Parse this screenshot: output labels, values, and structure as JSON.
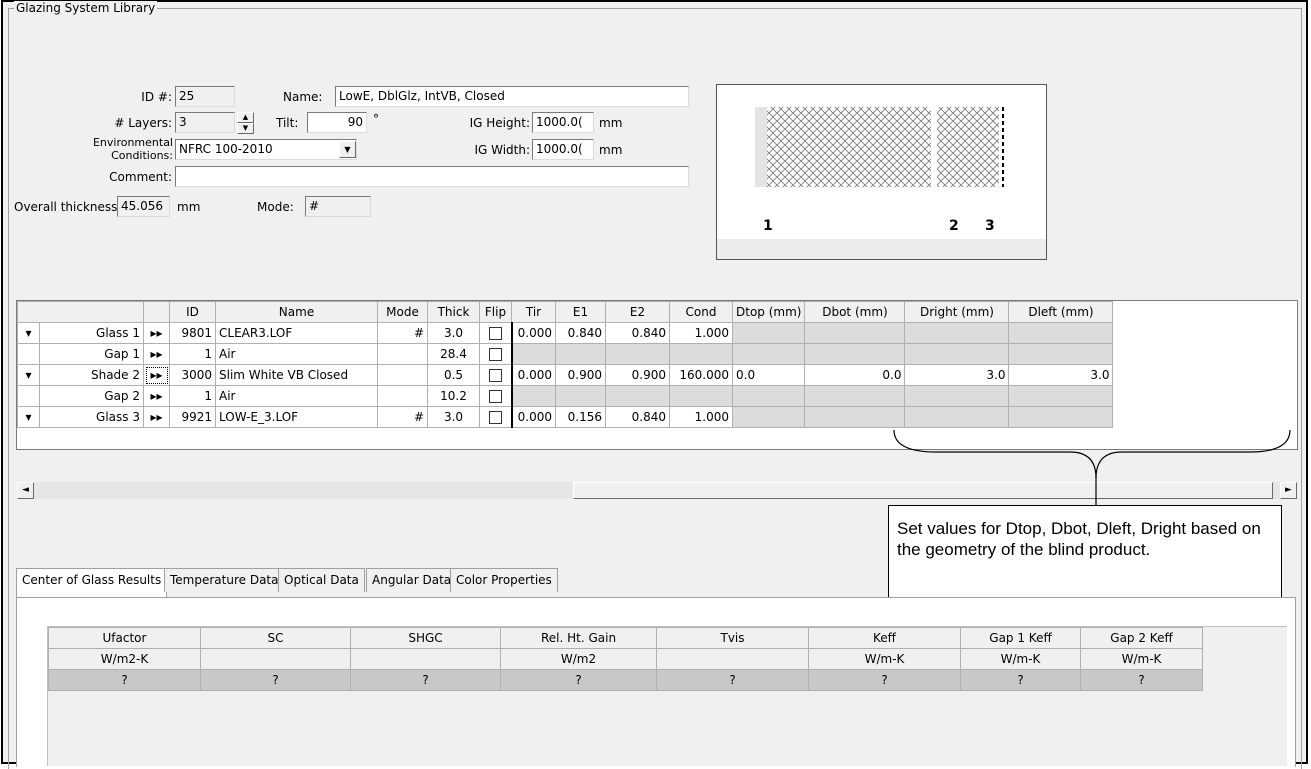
{
  "group_title": "Glazing System Library",
  "form": {
    "id_label": "ID #:",
    "id_value": "25",
    "name_label": "Name:",
    "name_value": "LowE, DblGlz, IntVB, Closed",
    "layers_label": "# Layers:",
    "layers_value": "3",
    "tilt_label": "Tilt:",
    "tilt_value": "90",
    "tilt_unit": "°",
    "ig_height_label": "IG Height:",
    "ig_height_value": "1000.0(",
    "ig_height_unit": "mm",
    "env_label_1": "Environmental",
    "env_label_2": "Conditions:",
    "env_value": "NFRC 100-2010",
    "ig_width_label": "IG Width:",
    "ig_width_value": "1000.0(",
    "ig_width_unit": "mm",
    "comment_label": "Comment:",
    "comment_value": "",
    "overall_label": "Overall thickness:",
    "overall_value": "45.056",
    "overall_unit": "mm",
    "mode_label": "Mode:",
    "mode_value": "#"
  },
  "preview": {
    "labels": [
      "1",
      "2",
      "3"
    ]
  },
  "layer_table": {
    "headers": [
      "",
      "",
      "ID",
      "Name",
      "Mode",
      "Thick",
      "Flip",
      "Tir",
      "E1",
      "E2",
      "Cond",
      "Dtop (mm)",
      "Dbot (mm)",
      "Dright (mm)",
      "Dleft (mm)"
    ],
    "rows": [
      {
        "label": "Glass 1",
        "id": "9801",
        "name": "CLEAR3.LOF",
        "mode": "#",
        "thick": "3.0",
        "tir": "0.000",
        "e1": "0.840",
        "e2": "0.840",
        "cond": "1.000",
        "dtop": "",
        "dbot": "",
        "dright": "",
        "dleft": ""
      },
      {
        "label": "Gap 1",
        "id": "1",
        "name": "Air",
        "mode": "",
        "thick": "28.4",
        "tir": "",
        "e1": "",
        "e2": "",
        "cond": "",
        "dtop": "",
        "dbot": "",
        "dright": "",
        "dleft": ""
      },
      {
        "label": "Shade 2",
        "id": "3000",
        "name": "Slim White VB Closed",
        "mode": "",
        "thick": "0.5",
        "tir": "0.000",
        "e1": "0.900",
        "e2": "0.900",
        "cond": "160.000",
        "dtop": "0.0",
        "dbot": "0.0",
        "dright": "3.0",
        "dleft": "3.0"
      },
      {
        "label": "Gap 2",
        "id": "1",
        "name": "Air",
        "mode": "",
        "thick": "10.2",
        "tir": "",
        "e1": "",
        "e2": "",
        "cond": "",
        "dtop": "",
        "dbot": "",
        "dright": "",
        "dleft": ""
      },
      {
        "label": "Glass 3",
        "id": "9921",
        "name": "LOW-E_3.LOF",
        "mode": "#",
        "thick": "3.0",
        "tir": "0.000",
        "e1": "0.156",
        "e2": "0.840",
        "cond": "1.000",
        "dtop": "",
        "dbot": "",
        "dright": "",
        "dleft": ""
      }
    ]
  },
  "callout_text": "Set values for Dtop, Dbot, Dleft, Dright based on the geometry of the blind product.",
  "tabs": [
    "Center of Glass Results",
    "Temperature Data",
    "Optical Data",
    "Angular Data",
    "Color Properties"
  ],
  "results": {
    "headers": [
      "Ufactor",
      "SC",
      "SHGC",
      "Rel. Ht. Gain",
      "Tvis",
      "Keff",
      "Gap 1 Keff",
      "Gap 2 Keff"
    ],
    "units": [
      "W/m2-K",
      "",
      "",
      "W/m2",
      "",
      "W/m-K",
      "W/m-K",
      "W/m-K"
    ],
    "values": [
      "?",
      "?",
      "?",
      "?",
      "?",
      "?",
      "?",
      "?"
    ]
  },
  "icons": {
    "spin_up": "▲",
    "spin_down": "▼",
    "dropdown": "▼",
    "row_dropdown": "▾",
    "row_nav": "▸▸",
    "scroll_left": "◄",
    "scroll_right": "►"
  }
}
